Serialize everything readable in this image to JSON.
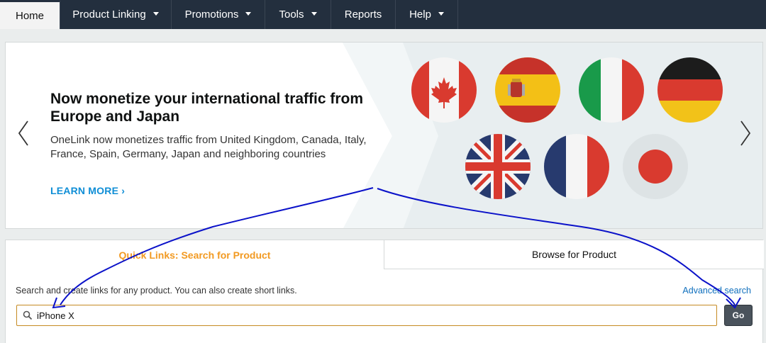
{
  "nav": {
    "items": [
      {
        "label": "Home",
        "active": true,
        "dropdown": false
      },
      {
        "label": "Product Linking",
        "active": false,
        "dropdown": true
      },
      {
        "label": "Promotions",
        "active": false,
        "dropdown": true
      },
      {
        "label": "Tools",
        "active": false,
        "dropdown": true
      },
      {
        "label": "Reports",
        "active": false,
        "dropdown": false
      },
      {
        "label": "Help",
        "active": false,
        "dropdown": true
      }
    ]
  },
  "banner": {
    "headline": "Now monetize your international traffic from Europe and Japan",
    "description": "OneLink now monetizes traffic from United Kingdom, Canada, Italy, France, Spain, Germany, Japan and neighboring countries",
    "cta": "LEARN MORE ›",
    "prev_icon": "chevron-left-icon",
    "next_icon": "chevron-right-icon",
    "flags": [
      "canada",
      "spain",
      "italy",
      "germany",
      "united-kingdom",
      "france",
      "japan"
    ]
  },
  "search": {
    "tabs": [
      {
        "label": "Quick Links: Search for Product",
        "active": true
      },
      {
        "label": "Browse for Product",
        "active": false
      }
    ],
    "help_text": "Search and create links for any product. You can also create short links.",
    "advanced_link": "Advanced search",
    "input_value": "iPhone X",
    "go_label": "Go",
    "icon": "search-icon"
  },
  "colors": {
    "nav_bg": "#232f3e",
    "accent_orange": "#f29a22",
    "link_blue": "#0f8ed6",
    "annotation": "#0000cc"
  }
}
